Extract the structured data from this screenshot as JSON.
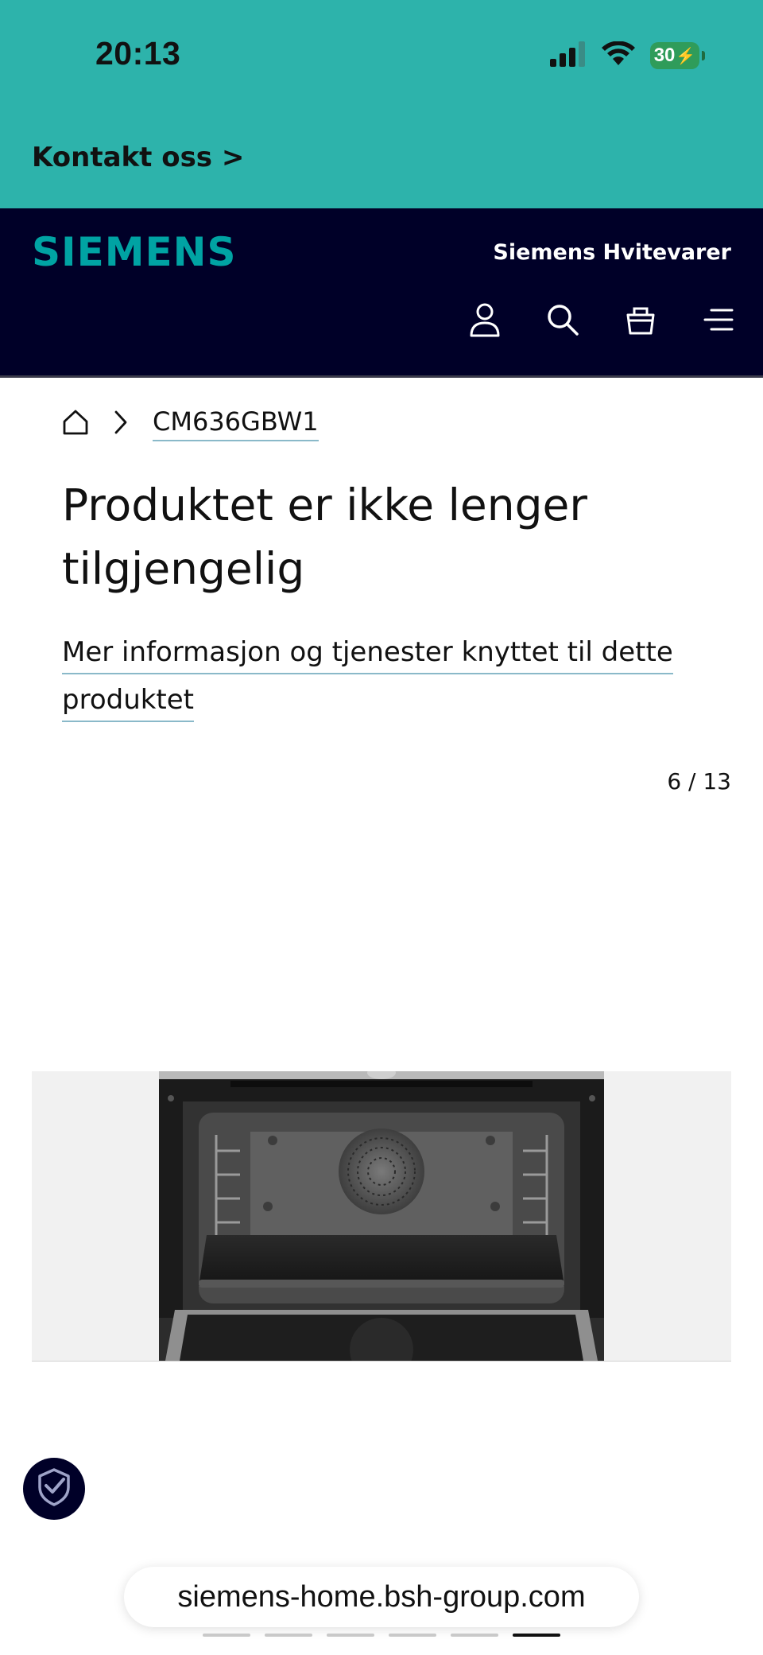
{
  "status_bar": {
    "time": "20:13",
    "battery": "30",
    "icons": [
      "signal-icon",
      "wifi-icon",
      "battery-charging-icon"
    ]
  },
  "contact": {
    "label": "Kontakt oss >"
  },
  "header": {
    "logo": "SIEMENS",
    "tagline": "Siemens Hvitevarer",
    "icons": [
      "user-icon",
      "search-icon",
      "basket-icon",
      "menu-icon"
    ]
  },
  "breadcrumb": {
    "home_icon": "home-icon",
    "separator_icon": "chevron-right-icon",
    "product": "CM636GBW1"
  },
  "main": {
    "title": "Produktet er ikke lenger tilgjengelig",
    "info_link": "Mer informasjon og tjenester knyttet til dette produktet",
    "gallery_counter": "6 / 13"
  },
  "badge": {
    "icon": "shield-check-icon"
  },
  "browser": {
    "url": "siemens-home.bsh-group.com",
    "tab_count": 6,
    "active_tab": 6
  },
  "colors": {
    "teal": "#2db3ab",
    "navy": "#000028",
    "logo_teal": "#00a3a3",
    "link_underline": "#8ab9c9"
  }
}
